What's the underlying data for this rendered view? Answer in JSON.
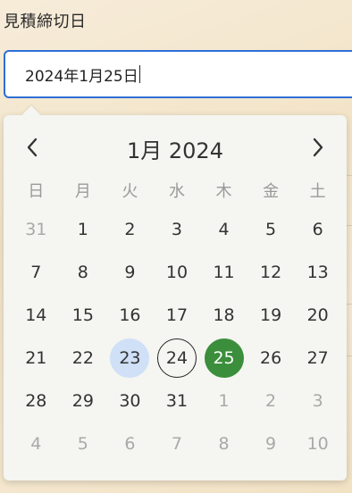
{
  "field": {
    "label": "見積締切日",
    "value": "2024年1月25日"
  },
  "calendar": {
    "month_title": "1月 2024",
    "prev_label": "previous-month",
    "next_label": "next-month",
    "weekdays": [
      "日",
      "月",
      "火",
      "水",
      "木",
      "金",
      "土"
    ],
    "weeks": [
      [
        {
          "d": "31",
          "s": "muted"
        },
        {
          "d": "1",
          "s": ""
        },
        {
          "d": "2",
          "s": ""
        },
        {
          "d": "3",
          "s": ""
        },
        {
          "d": "4",
          "s": ""
        },
        {
          "d": "5",
          "s": ""
        },
        {
          "d": "6",
          "s": ""
        }
      ],
      [
        {
          "d": "7",
          "s": ""
        },
        {
          "d": "8",
          "s": ""
        },
        {
          "d": "9",
          "s": ""
        },
        {
          "d": "10",
          "s": ""
        },
        {
          "d": "11",
          "s": ""
        },
        {
          "d": "12",
          "s": ""
        },
        {
          "d": "13",
          "s": ""
        }
      ],
      [
        {
          "d": "14",
          "s": ""
        },
        {
          "d": "15",
          "s": ""
        },
        {
          "d": "16",
          "s": ""
        },
        {
          "d": "17",
          "s": ""
        },
        {
          "d": "18",
          "s": ""
        },
        {
          "d": "19",
          "s": ""
        },
        {
          "d": "20",
          "s": ""
        }
      ],
      [
        {
          "d": "21",
          "s": ""
        },
        {
          "d": "22",
          "s": ""
        },
        {
          "d": "23",
          "s": "range"
        },
        {
          "d": "24",
          "s": "today"
        },
        {
          "d": "25",
          "s": "selected"
        },
        {
          "d": "26",
          "s": ""
        },
        {
          "d": "27",
          "s": ""
        }
      ],
      [
        {
          "d": "28",
          "s": ""
        },
        {
          "d": "29",
          "s": ""
        },
        {
          "d": "30",
          "s": ""
        },
        {
          "d": "31",
          "s": ""
        },
        {
          "d": "1",
          "s": "muted"
        },
        {
          "d": "2",
          "s": "muted"
        },
        {
          "d": "3",
          "s": "muted"
        }
      ],
      [
        {
          "d": "4",
          "s": "muted"
        },
        {
          "d": "5",
          "s": "muted"
        },
        {
          "d": "6",
          "s": "muted"
        },
        {
          "d": "7",
          "s": "muted"
        },
        {
          "d": "8",
          "s": "muted"
        },
        {
          "d": "9",
          "s": "muted"
        },
        {
          "d": "10",
          "s": "muted"
        }
      ]
    ],
    "colors": {
      "selected": "#3b8e3b",
      "range": "#cfe0f7",
      "input_border": "#2f6fd6"
    }
  }
}
